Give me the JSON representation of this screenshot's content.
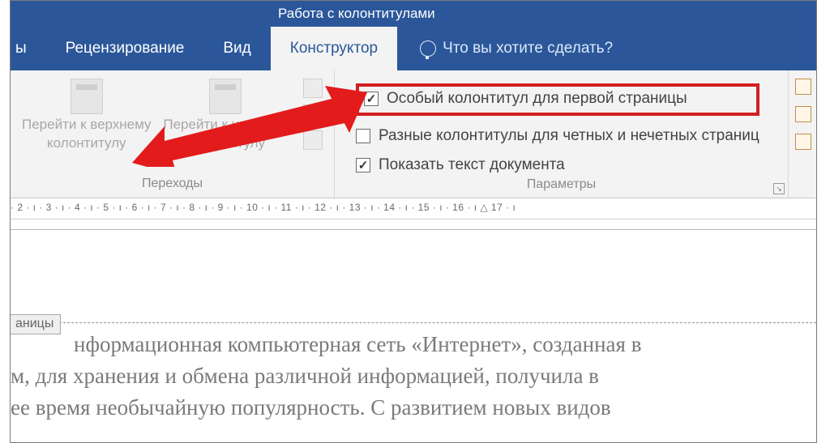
{
  "contextTab": "Работа с колонтитулами",
  "tabs": {
    "partial": "ы",
    "review": "Рецензирование",
    "view": "Вид",
    "designer": "Конструктор"
  },
  "tellme": "Что вы хотите сделать?",
  "transitions": {
    "prev": {
      "line1": "Перейти к верхнему",
      "line2": "колонтитулу"
    },
    "next": {
      "line1": "Перейти к нижнему",
      "line2": "колонтитулу"
    },
    "groupLabel": "Переходы"
  },
  "params": {
    "firstPage": "Особый колонтитул для первой страницы",
    "oddEven": "Разные колонтитулы для четных и нечетных страниц",
    "showText": "Показать текст документа",
    "groupLabel": "Параметры"
  },
  "ruler": "· 2 · ı · 3 · ı · 4 · ı · 5 · ı · 6 · ı · 7 · ı · 8 · ı · 9 · ı · 10 · ı · 11 · ı · 12 · ı · 13 · ı · 14 · ı · 15 · ı · 16 · ı △ 17 · ı",
  "headerTab": "аницы",
  "body": {
    "l1": "нформационная компьютерная сеть «Интернет», созданная в",
    "l2": "м, для хранения и обмена различной информацией, получила в",
    "l3": "ее время необычайную популярность. С развитием новых видов"
  }
}
